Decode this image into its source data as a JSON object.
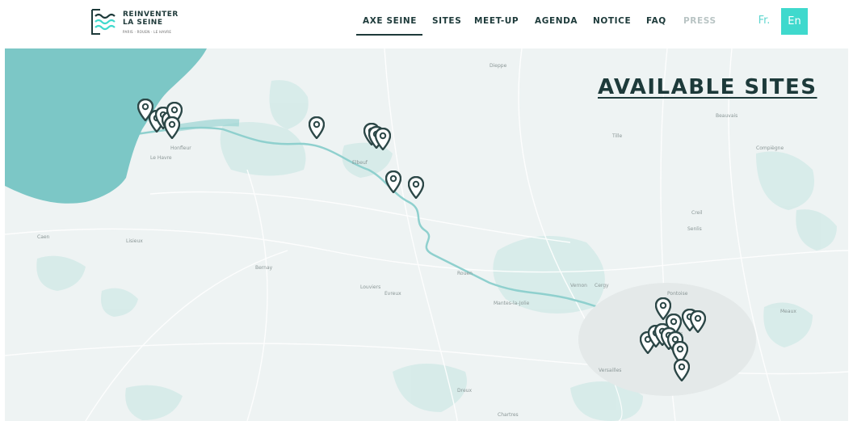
{
  "logo": {
    "title": "REINVENTER\nLA SEINE",
    "subtitle": "PARIS · ROUEN · LE HAVRE"
  },
  "nav": {
    "items": [
      {
        "label": "AXE SEINE",
        "active": true,
        "muted": false
      },
      {
        "label": "SITES",
        "active": false,
        "muted": false
      },
      {
        "label": "MEET-UP",
        "active": false,
        "muted": false
      },
      {
        "label": "AGENDA",
        "active": false,
        "muted": false
      },
      {
        "label": "NOTICE",
        "active": false,
        "muted": false
      },
      {
        "label": "FAQ",
        "active": false,
        "muted": false
      },
      {
        "label": "PRESS",
        "active": false,
        "muted": true
      }
    ],
    "lang_fr": "Fr.",
    "lang_en": "En"
  },
  "map": {
    "title": "AVAILABLE SITES",
    "places": [
      "Caen",
      "Dieppe",
      "Rouen",
      "Evreux",
      "Vernon",
      "Versailles",
      "Paris",
      "Beauvais",
      "Pontoise",
      "Mantes-la-Jolie",
      "Bernay",
      "Lisieux",
      "Le Havre",
      "Honfleur",
      "Elbeuf",
      "Louviers",
      "Dreux",
      "Chartres",
      "Compiègne",
      "Senlis",
      "Creil",
      "Meaux",
      "Tille",
      "Cergy"
    ]
  },
  "colors": {
    "accent": "#3fd9cd",
    "dark": "#1d3a3a",
    "sea": "#7cc7c6",
    "map_bg": "#eef3f3",
    "forest": "#d3e9e7",
    "pin": "#2c4747"
  }
}
